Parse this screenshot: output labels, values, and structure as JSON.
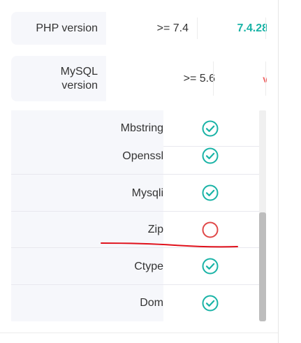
{
  "requirements": [
    {
      "name": "PHP version",
      "required": ">= 7.4",
      "current": "7.4.28",
      "status_color": "#19b3a6"
    },
    {
      "name": "MySQL version",
      "required": ">= 5.6",
      "current": "v",
      "status_color": "#f06262"
    }
  ],
  "extensions": [
    {
      "name": "Mbstring",
      "status": "ok"
    },
    {
      "name": "Openssl",
      "status": "ok"
    },
    {
      "name": "Mysqli",
      "status": "ok"
    },
    {
      "name": "Zip",
      "status": "missing"
    },
    {
      "name": "Ctype",
      "status": "ok"
    },
    {
      "name": "Dom",
      "status": "ok"
    }
  ],
  "colors": {
    "ok": "#19b3a6",
    "missing": "#e04848",
    "annotation": "#e0101a"
  },
  "icons": {
    "ok": "check-circle-icon",
    "missing": "empty-circle-icon"
  }
}
